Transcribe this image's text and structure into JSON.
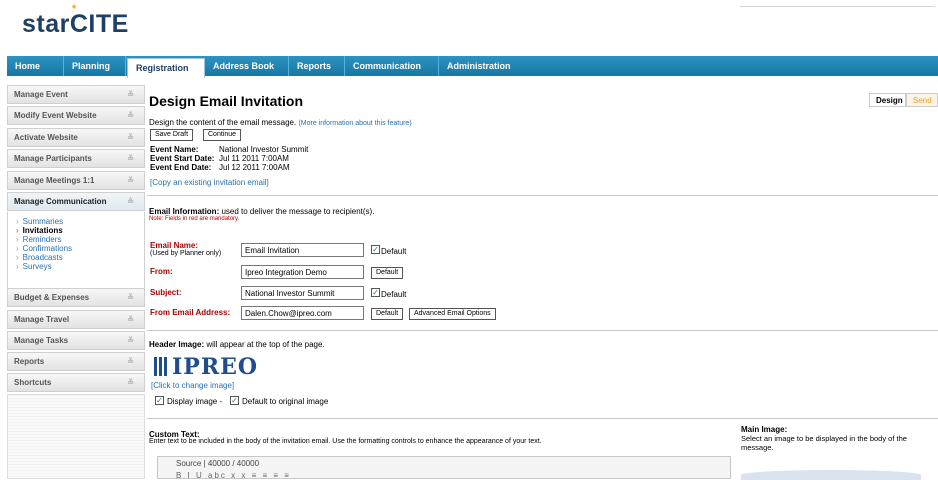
{
  "brand": {
    "logo_text": "starCITE",
    "logo_star": "*"
  },
  "nav": {
    "tabs": [
      "Home",
      "Planning",
      "Registration",
      "Address Book",
      "Reports",
      "Communication",
      "Administration"
    ],
    "active_index": 2
  },
  "sidebar": {
    "items": [
      "Manage Event",
      "Modify Event Website",
      "Activate Website",
      "Manage Participants",
      "Manage Meetings 1:1",
      "Manage Communication",
      "Budget & Expenses",
      "Manage Travel",
      "Manage Tasks",
      "Reports",
      "Shortcuts"
    ],
    "open_index": 5,
    "subitems": [
      "Summaries",
      "Invitations",
      "Reminders",
      "Confirmations",
      "Broadcasts",
      "Surveys"
    ],
    "current_subitem_index": 1
  },
  "page": {
    "title": "Design Email Invitation",
    "tabs": {
      "design": "Design",
      "send": "Send"
    },
    "intro": "Design the content of the email message.",
    "intro_link": "(More information about this feature)",
    "save_draft": "Save Draft",
    "continue": "Continue",
    "event_name_label": "Event Name:",
    "event_name": "National Investor Summit",
    "start_label": "Event Start Date:",
    "start_date": "Jul 11 2011 7:00AM",
    "end_label": "Event End Date:",
    "end_date": "Jul 12 2011 7:00AM",
    "copy_link": "[Copy an existing invitation email]"
  },
  "email_info": {
    "heading": "Email Information:",
    "heading_rest": " used to deliver the message to recipient(s).",
    "note": "Note: Fields in red are mandatory.",
    "name_label": "Email Name:",
    "name_sub": "(Used by Planner only)",
    "name_value": "Email Invitation",
    "from_label": "From:",
    "from_value": "Ipreo Integration Demo",
    "subject_label": "Subject:",
    "subject_value": "National Investor Summit",
    "from_email_label": "From Email Address:",
    "from_email_value": "Dalen.Chow@ipreo.com",
    "default_label": "Default",
    "advanced_label": "Advanced Email Options"
  },
  "header_image": {
    "heading": "Header Image:",
    "heading_rest": " will appear at the top of the page.",
    "logo_text": "IPREO",
    "change_link": "[Click to change image]",
    "display_label": "Display image -",
    "default_label": "Default to original image"
  },
  "custom_text": {
    "heading": "Custom Text:",
    "desc": "Enter text to be included in the body of the invitation email. Use the formatting controls to enhance the appearance of your text.",
    "toolbar": "Source  |  40000 / 40000",
    "toolbar_icons": "B I U abc x x  ≡ ≡ ≡ ≡"
  },
  "main_image": {
    "heading": "Main Image:",
    "desc1": "Select an image to be displayed in the body of the",
    "desc2": "message."
  },
  "colors": {
    "nav": "#1677a6",
    "required": "#b30000",
    "link": "#2a6fb0",
    "logo": "#1f3f66",
    "send": "#f2a31b"
  }
}
